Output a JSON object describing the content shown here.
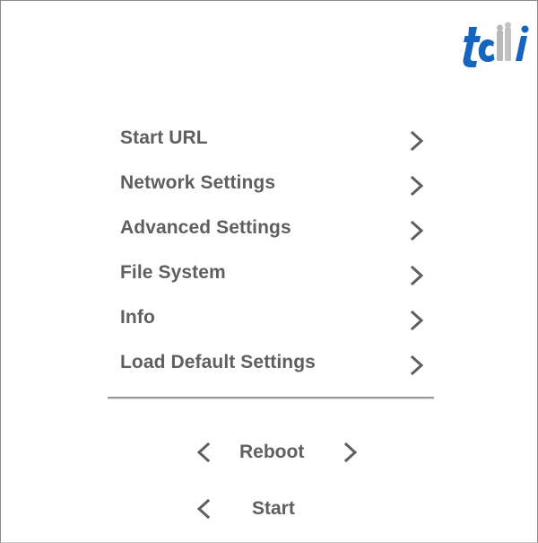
{
  "logo": {
    "text": "tcmi",
    "colors": {
      "primary": "#1565c0",
      "secondary": "#b8b8b8"
    }
  },
  "menu": {
    "items": [
      {
        "label": "Start URL",
        "icon": "chevron-right-icon"
      },
      {
        "label": "Network Settings",
        "icon": "chevron-right-icon"
      },
      {
        "label": "Advanced Settings",
        "icon": "chevron-right-icon"
      },
      {
        "label": "File System",
        "icon": "chevron-right-icon"
      },
      {
        "label": "Info",
        "icon": "chevron-right-icon"
      },
      {
        "label": "Load Default Settings",
        "icon": "chevron-right-icon"
      }
    ]
  },
  "actions": {
    "reboot_label": "Reboot",
    "start_label": "Start"
  },
  "colors": {
    "text": "#5f5f5f",
    "divider": "#9a9a9a",
    "border": "#8a8a8a"
  }
}
